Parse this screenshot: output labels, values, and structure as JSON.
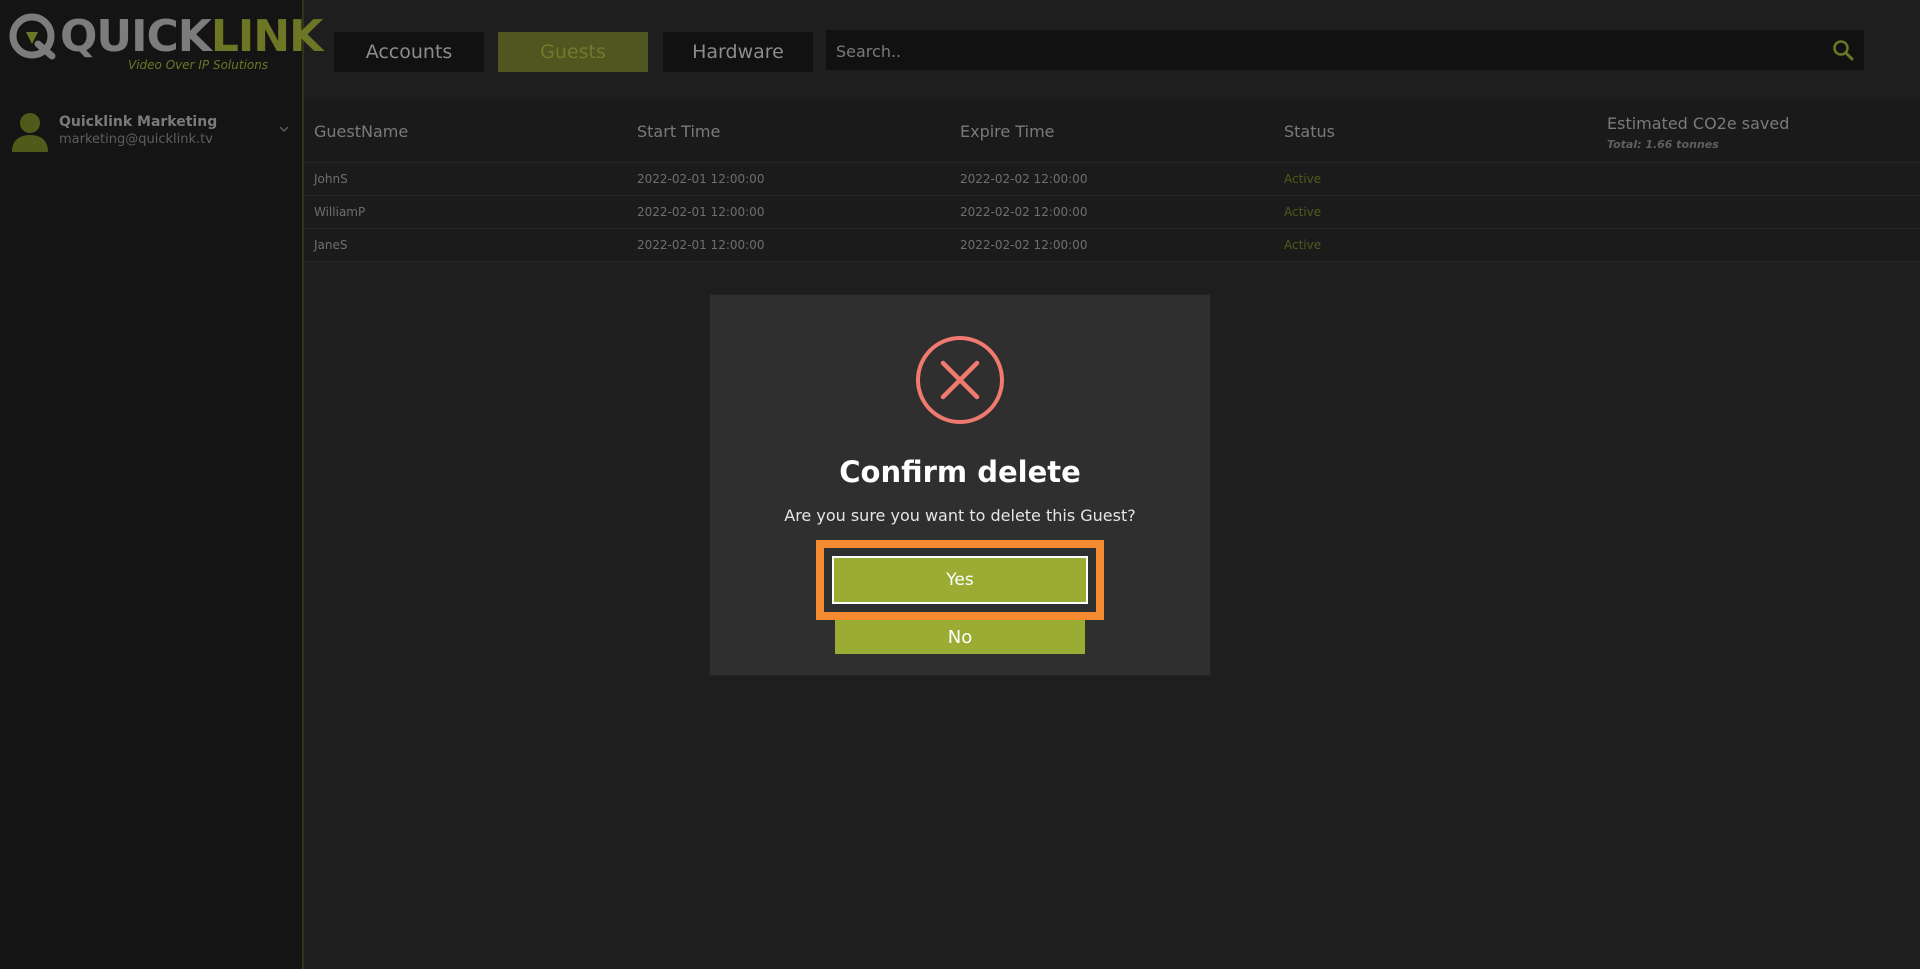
{
  "brand": {
    "name_part1": "QUICK",
    "name_part2": "LINK",
    "tagline": "Video Over IP Solutions"
  },
  "user": {
    "name": "Quicklink Marketing",
    "email": "marketing@quicklink.tv"
  },
  "nav": {
    "tabs": [
      {
        "label": "Accounts",
        "active": false
      },
      {
        "label": "Guests",
        "active": true
      },
      {
        "label": "Hardware",
        "active": false
      }
    ],
    "search_placeholder": "Search.."
  },
  "table": {
    "columns": [
      "GuestName",
      "Start Time",
      "Expire Time",
      "Status",
      "Estimated CO2e saved"
    ],
    "co2_total": "Total: 1.66 tonnes",
    "rows": [
      {
        "name": "JohnS",
        "start": "2022-02-01 12:00:00",
        "expire": "2022-02-02 12:00:00",
        "status": "Active"
      },
      {
        "name": "WilliamP",
        "start": "2022-02-01 12:00:00",
        "expire": "2022-02-02 12:00:00",
        "status": "Active"
      },
      {
        "name": "JaneS",
        "start": "2022-02-01 12:00:00",
        "expire": "2022-02-02 12:00:00",
        "status": "Active"
      }
    ]
  },
  "modal": {
    "title": "Confirm delete",
    "message": "Are you sure you want to delete this Guest?",
    "yes_label": "Yes",
    "no_label": "No",
    "icon": "close-circle-icon"
  },
  "colors": {
    "accent": "#9bac35",
    "highlight": "#f58b2e",
    "danger": "#f07a70"
  }
}
